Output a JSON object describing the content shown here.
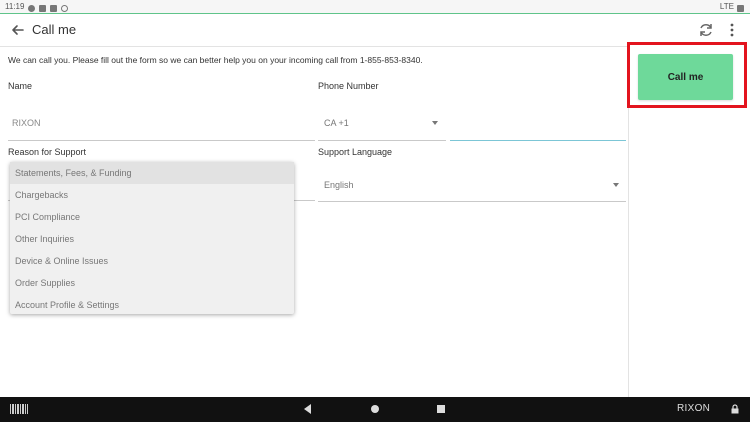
{
  "status_bar": {
    "time": "11:19",
    "network": "LTE"
  },
  "app_bar": {
    "title": "Call me"
  },
  "intro_text": "We can call you. Please fill out the form so we can better help you on your incoming call from 1-855-853-8340.",
  "form": {
    "name_label": "Name",
    "name_value": "RIXON",
    "phone_label": "Phone Number",
    "country_code": "CA +1",
    "phone_value": "",
    "reason_label": "Reason for Support",
    "language_label": "Support Language",
    "language_value": "English"
  },
  "reason_options": [
    "Statements, Fees, & Funding",
    "Chargebacks",
    "PCI Compliance",
    "Other Inquiries",
    "Device & Online Issues",
    "Order Supplies",
    "Account Profile & Settings"
  ],
  "call_button_label": "Call me",
  "nav_bar": {
    "user_label": "RIXON"
  },
  "colors": {
    "call_button": "#6ed99a",
    "highlight_border": "#e3141e",
    "active_field_underline": "#7cc6d6"
  }
}
